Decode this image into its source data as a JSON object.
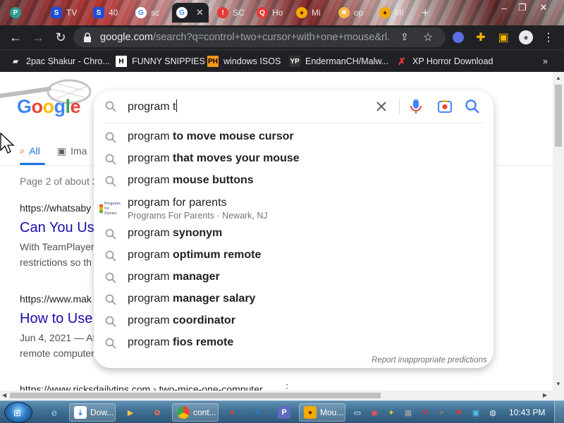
{
  "tabs": [
    {
      "title": "TV",
      "icon": "s-icon",
      "active": false
    },
    {
      "title": "40",
      "icon": "s-icon",
      "active": false
    },
    {
      "title": "sc",
      "icon": "google-icon",
      "active": false
    },
    {
      "title": "",
      "icon": "google-icon",
      "active": true
    },
    {
      "title": "SC",
      "icon": "stop-icon",
      "active": false
    },
    {
      "title": "Ho",
      "icon": "search-icon",
      "active": false
    },
    {
      "title": "Mi",
      "icon": "pizza-icon",
      "active": false
    },
    {
      "title": "op",
      "icon": "sun-icon",
      "active": false
    },
    {
      "title": "Mi",
      "icon": "pizza-icon",
      "active": false
    }
  ],
  "address_bar": {
    "domain": "google.com",
    "path": "/search?q=control+two+cursor+with+one+mouse&rl..."
  },
  "bookmarks": [
    {
      "label": "2pac Shakur - Chro...",
      "icon": "folder-icon"
    },
    {
      "label": "FUNNY SNIPPIES",
      "icon": "h-icon"
    },
    {
      "label": "windows ISOS",
      "icon": "ph-icon"
    },
    {
      "label": "EndermanCH/Malw...",
      "icon": "yp-icon"
    },
    {
      "label": "XP Horror Download",
      "icon": "x-icon"
    }
  ],
  "search": {
    "query": "program t",
    "suggestions": [
      {
        "prefix": "program ",
        "bold": "to move mouse cursor"
      },
      {
        "prefix": "program ",
        "bold": "that moves your mouse"
      },
      {
        "prefix": "program ",
        "bold": "mouse buttons"
      },
      {
        "prefix": "program for parents",
        "bold": "",
        "subtitle": "Programs For Parents · Newark, NJ",
        "thumb_text": "Programs for Parents"
      },
      {
        "prefix": "program ",
        "bold": "synonym"
      },
      {
        "prefix": "program ",
        "bold": "optimum remote"
      },
      {
        "prefix": "program ",
        "bold": "manager"
      },
      {
        "prefix": "program ",
        "bold": "manager salary"
      },
      {
        "prefix": "program ",
        "bold": "coordinator"
      },
      {
        "prefix": "program ",
        "bold": "fios remote"
      }
    ],
    "report_link": "Report inappropriate predictions"
  },
  "page": {
    "logo": "Google",
    "tabs": [
      "All",
      "Ima"
    ],
    "stats": "Page 2 of about 2",
    "results": [
      {
        "url": "https://whatsaby",
        "title": "Can You Use",
        "snippet": [
          "With TeamPlayer,",
          "restrictions so th"
        ]
      },
      {
        "url": "https://www.mak",
        "title": "How to Use",
        "snippet": [
          "Jun 4, 2021 — Af",
          "remote computer"
        ]
      },
      {
        "url": "https://www.ricksdailytips.com › two-mice-one-computer",
        "title": "",
        "snippet": []
      }
    ]
  },
  "taskbar": {
    "apps": [
      {
        "label": "Dow...",
        "icon": "chrome-download-icon",
        "boxed": true
      },
      {
        "label": "cont...",
        "icon": "chrome-icon",
        "boxed": true
      },
      {
        "label": "Mou...",
        "icon": "pizza-icon",
        "boxed": true
      }
    ],
    "clock": "10:43 PM"
  },
  "colors": {
    "link": "#1a0dab",
    "accent": "#1a73e8",
    "chrome_dark": "#202124"
  }
}
